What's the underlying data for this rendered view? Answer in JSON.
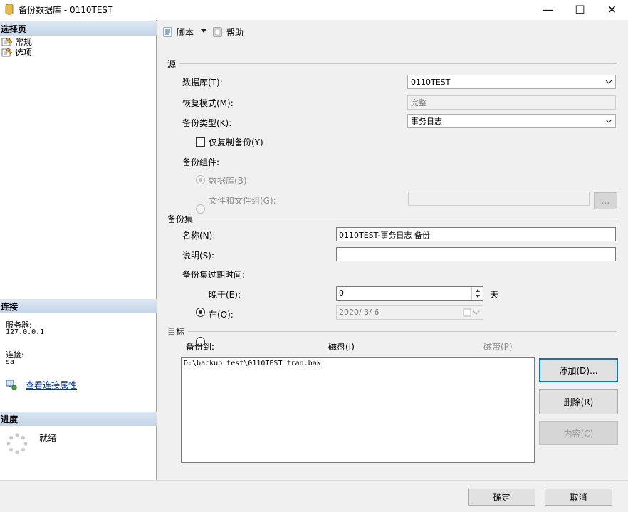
{
  "window": {
    "title": "备份数据库 - 0110TEST",
    "minimize": "—",
    "maximize": "☐",
    "close": "✕"
  },
  "left": {
    "select_page_header": "选择页",
    "pages": [
      "常规",
      "选项"
    ],
    "connection_header": "连接",
    "server_label": "服务器:",
    "server_value": "127.0.0.1",
    "connection_label": "连接:",
    "connection_value": "sa",
    "view_conn_props": "查看连接属性",
    "progress_header": "进度",
    "progress_status": "就绪"
  },
  "toolbar": {
    "script_label": "脚本",
    "help_label": "帮助"
  },
  "source": {
    "section": "源",
    "database_label": "数据库(T):",
    "database_value": "0110TEST",
    "recovery_label": "恢复模式(M):",
    "recovery_value": "完整",
    "backup_type_label": "备份类型(K):",
    "backup_type_value": "事务日志",
    "copy_only_label": "仅复制备份(Y)",
    "component_label": "备份组件:",
    "comp_database": "数据库(B)",
    "comp_files": "文件和文件组(G):",
    "files_browse": "..."
  },
  "backup_set": {
    "section": "备份集",
    "name_label": "名称(N):",
    "name_value": "0110TEST-事务日志  备份",
    "desc_label": "说明(S):",
    "desc_value": "",
    "expire_label": "备份集过期时间:",
    "after_label": "晚于(E):",
    "after_value": "0",
    "days_unit": "天",
    "on_label": "在(O):",
    "on_value": "2020/ 3/ 6"
  },
  "destination": {
    "section": "目标",
    "backup_to_label": "备份到:",
    "disk_label": "磁盘(I)",
    "tape_label": "磁带(P)",
    "paths": [
      "D:\\backup_test\\0110TEST_tran.bak"
    ],
    "add_button": "添加(D)...",
    "remove_button": "删除(R)",
    "contents_button": "内容(C)"
  },
  "footer": {
    "ok": "确定",
    "cancel": "取消"
  },
  "colors": {
    "header_gradient_top": "#dce7f3",
    "header_gradient_bottom": "#c4d5e8",
    "focus_blue": "#0078d7",
    "link": "#0033aa"
  }
}
